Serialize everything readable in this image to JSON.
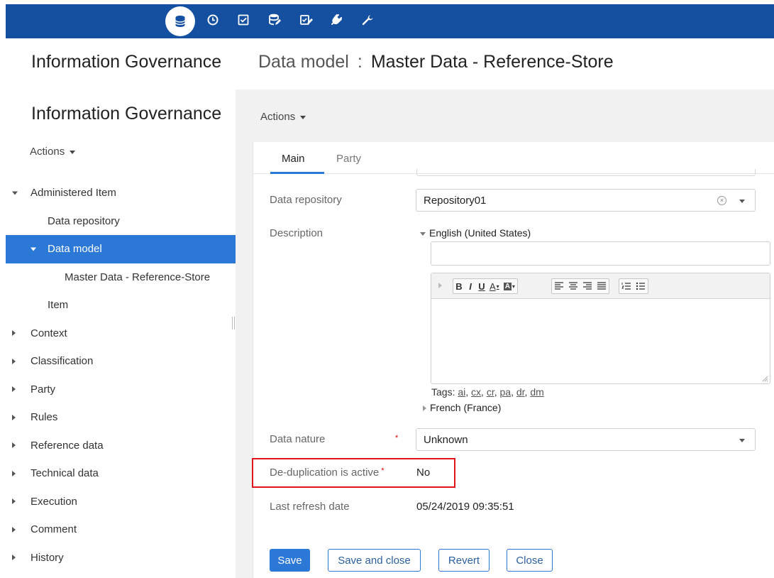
{
  "app": {
    "title": "Information Governance"
  },
  "header": {
    "label": "Data model",
    "separator": ":",
    "title": "Master Data - Reference-Store"
  },
  "toolbar": {
    "icons": [
      "database-icon",
      "clock-icon",
      "checkbox-icon",
      "database-edit-icon",
      "checklist-edit-icon",
      "plugin-icon",
      "wrench-icon"
    ],
    "active_icon": "database-icon",
    "active_color": "#1550a0"
  },
  "sidebar": {
    "title": "Information Governance",
    "actions_label": "Actions",
    "tree": [
      {
        "label": "Administered Item",
        "expanded": true,
        "level": 0
      },
      {
        "label": "Data repository",
        "level": 1
      },
      {
        "label": "Data model",
        "level": 1,
        "expanded": true,
        "selected": true
      },
      {
        "label": "Master Data - Reference-Store",
        "level": 2
      },
      {
        "label": "Item",
        "level": 1
      },
      {
        "label": "Context",
        "level": 0
      },
      {
        "label": "Classification",
        "level": 0
      },
      {
        "label": "Party",
        "level": 0
      },
      {
        "label": "Rules",
        "level": 0
      },
      {
        "label": "Reference data",
        "level": 0
      },
      {
        "label": "Technical data",
        "level": 0
      },
      {
        "label": "Execution",
        "level": 0
      },
      {
        "label": "Comment",
        "level": 0
      },
      {
        "label": "History",
        "level": 0
      }
    ],
    "selected_color": "#2b78d6"
  },
  "main": {
    "actions_label": "Actions",
    "tabs": [
      {
        "label": "Main",
        "active": true
      },
      {
        "label": "Party",
        "active": false
      }
    ],
    "form": {
      "data_repository": {
        "label": "Data repository",
        "value": "Repository01"
      },
      "description": {
        "label": "Description",
        "languages": [
          "English (United States)",
          "French (France)"
        ],
        "tags_label": "Tags:",
        "tags": [
          "ai",
          "cx",
          "cr",
          "pa",
          "dr",
          "dm"
        ],
        "tag_separator": ","
      },
      "data_nature": {
        "label": "Data nature",
        "value": "Unknown",
        "required_mark": "*"
      },
      "deduplication": {
        "label": "De-duplication is active",
        "value": "No",
        "required_mark": "*"
      },
      "last_refresh": {
        "label": "Last refresh date",
        "value": "05/24/2019 09:35:51"
      }
    },
    "editor_toolbar": {
      "bold": "B",
      "italic": "I",
      "underline": "U",
      "text_color": "A",
      "bg_color": "A"
    },
    "buttons": {
      "save": "Save",
      "save_close": "Save and close",
      "revert": "Revert",
      "close": "Close"
    }
  },
  "colors": {
    "highlight": "#e0141b",
    "accent": "#2b78d6"
  }
}
